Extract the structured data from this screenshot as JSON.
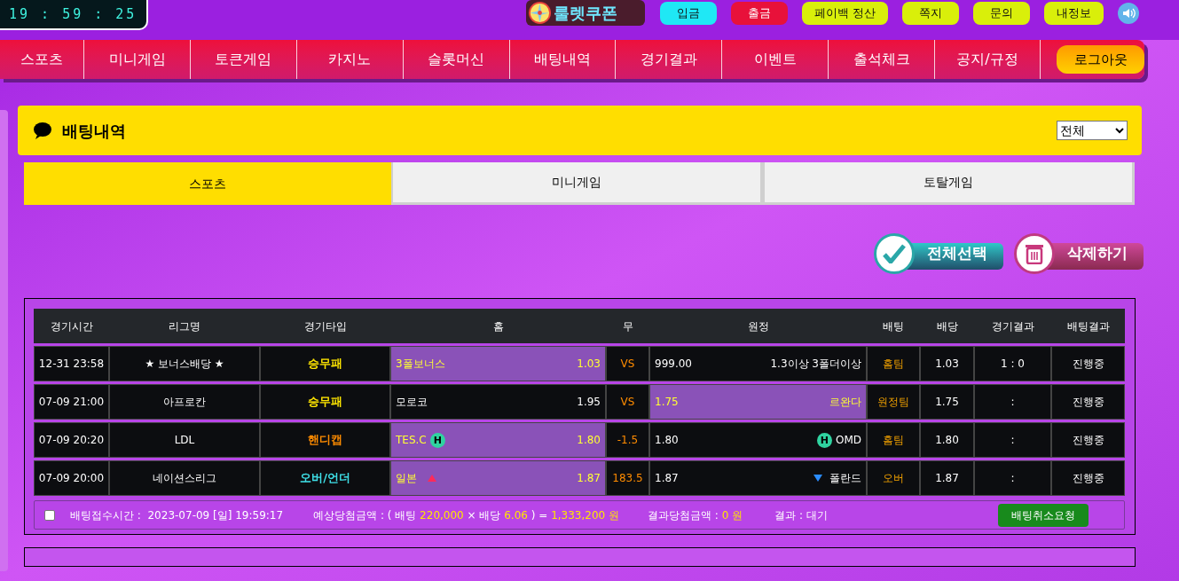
{
  "clock": "19 : 59 : 25",
  "logo": "룰렛쿠폰",
  "top_buttons": [
    {
      "label": "입금",
      "color": "#1fe8f5"
    },
    {
      "label": "출금",
      "color": "#e8113a"
    },
    {
      "label": "페이백 정산",
      "color": "#d9ef0a"
    },
    {
      "label": "쪽지",
      "color": "#d9ef0a"
    },
    {
      "label": "문의",
      "color": "#d9ef0a"
    },
    {
      "label": "내정보",
      "color": "#d9ef0a"
    }
  ],
  "nav": [
    {
      "label": "스포츠",
      "kind": "link"
    },
    {
      "label": "미니게임",
      "kind": "link"
    },
    {
      "label": "토큰게임",
      "kind": "link"
    },
    {
      "label": "카지노",
      "kind": "link"
    },
    {
      "label": "슬롯머신",
      "kind": "link"
    },
    {
      "label": "배팅내역",
      "kind": "link"
    },
    {
      "label": "경기결과",
      "kind": "link"
    },
    {
      "label": "이벤트",
      "kind": "link"
    },
    {
      "label": "출석체크",
      "kind": "link"
    },
    {
      "label": "공지/규정",
      "kind": "link"
    },
    {
      "label": "로그아웃",
      "kind": "logout"
    }
  ],
  "section": {
    "title": "배팅내역",
    "filter": "전체"
  },
  "tabs": [
    {
      "label": "스포츠",
      "selected": true
    },
    {
      "label": "미니게임",
      "selected": false
    },
    {
      "label": "토탈게임",
      "selected": false
    }
  ],
  "actions": [
    {
      "label": "전체선택",
      "kind": "select_all"
    },
    {
      "label": "삭제하기",
      "kind": "delete"
    }
  ],
  "table": {
    "columns": [
      "경기시간",
      "리그명",
      "경기타입",
      "홈",
      "무",
      "원정",
      "배팅",
      "배당",
      "경기결과",
      "배팅결과"
    ],
    "rows": [
      {
        "time": "12-31 23:58",
        "league": "★ 보너스배당 ★",
        "type": "승무패",
        "color": "#ffe600",
        "home": {
          "name": "3폴보너스",
          "odds": "1.03",
          "selected": true
        },
        "draw": "VS",
        "away": {
          "odds": "999.00",
          "name": "1.3이상 3폴더이상",
          "selected": false
        },
        "bet": "홈팀",
        "bet_odds": "1.03",
        "score": "1 : 0",
        "status": "진행중"
      },
      {
        "time": "07-09 21:00",
        "league": "아프로칸",
        "type": "승무패",
        "color": "#ffe600",
        "home": {
          "name": "모로코",
          "odds": "1.95",
          "selected": false
        },
        "draw": "VS",
        "away": {
          "odds": "1.75",
          "name": "르완다",
          "selected": true
        },
        "bet": "원정팀",
        "bet_odds": "1.75",
        "score": ":",
        "status": "진행중"
      },
      {
        "time": "07-09 20:20",
        "league": "LDL",
        "type": "핸디캡",
        "color": "#ff8c00",
        "home": {
          "name": "TES.C",
          "odds": "1.80",
          "selected": true,
          "marker": {
            "kind": "badge",
            "text": "H"
          }
        },
        "draw": "-1.5",
        "away": {
          "odds": "1.80",
          "name": "OMD",
          "selected": false,
          "marker": {
            "kind": "badge",
            "text": "H"
          }
        },
        "bet": "홈팀",
        "bet_odds": "1.80",
        "score": ":",
        "status": "진행중"
      },
      {
        "time": "07-09 20:00",
        "league": "네이션스리그",
        "type": "오버/언더",
        "color": "#3fe0e8",
        "home": {
          "name": "일본",
          "odds": "1.87",
          "selected": true,
          "marker": {
            "kind": "up"
          }
        },
        "draw": "183.5",
        "away": {
          "odds": "1.87",
          "name": "폴란드",
          "selected": false,
          "marker": {
            "kind": "down"
          }
        },
        "bet": "오버",
        "bet_odds": "1.87",
        "score": ":",
        "status": "진행중"
      }
    ]
  },
  "summary": {
    "checked": false,
    "receipt": "배팅접수시간 :  2023-07-09 [일] 19:59:17",
    "expected": [
      {
        "text": "예상당첨금액 : ( 배팅 ",
        "kind": "label"
      },
      {
        "text": "220,000",
        "kind": "value"
      },
      {
        "text": " × 배당 ",
        "kind": "label"
      },
      {
        "text": "6.06",
        "kind": "value"
      },
      {
        "text": " ) = ",
        "kind": "label"
      },
      {
        "text": "1,333,200 원",
        "kind": "value"
      }
    ],
    "result_amount": [
      {
        "text": "결과당첨금액 : ",
        "kind": "label"
      },
      {
        "text": "0 원",
        "kind": "value"
      }
    ],
    "result": "결과 : 대기",
    "cancel": "배팅취소요청"
  }
}
